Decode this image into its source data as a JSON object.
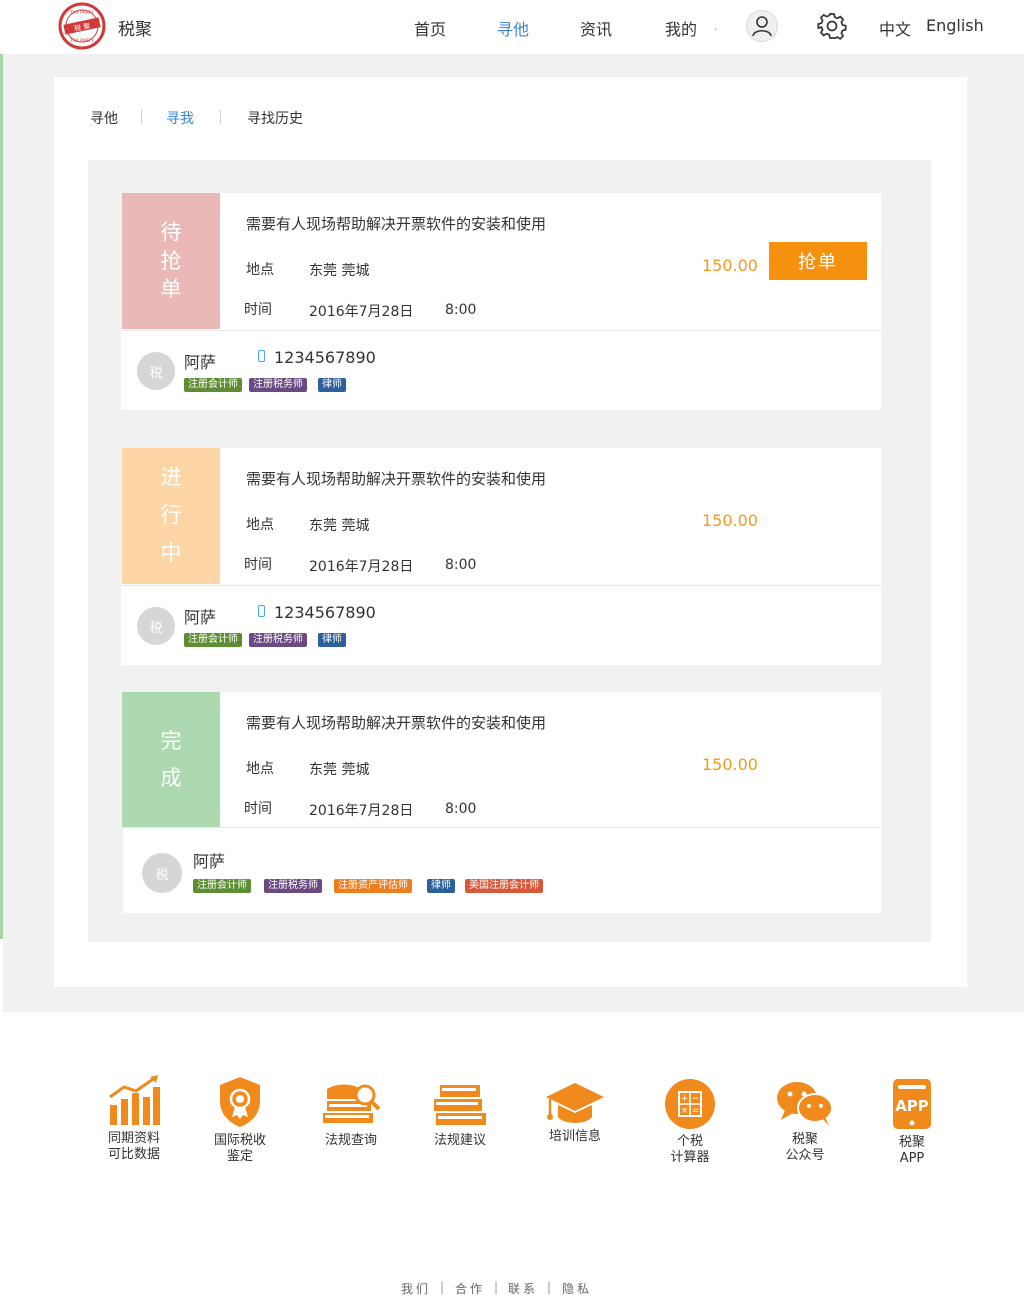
{
  "colors": {
    "accent": "#3b86d6",
    "orange": "#f6900f",
    "price": "#f39a1e",
    "status_pending": "#ebb8b8",
    "status_progress": "#fed6a6",
    "status_done": "#acd9b0",
    "tag_accountant": "#5e8e34",
    "tag_tax_agent": "#6a4a82",
    "tag_asset": "#ed7d1e",
    "tag_lawyer": "#2d5f9a",
    "tag_us_cpa": "#d8593a"
  },
  "header": {
    "logo_alt": "TAX PARTY 税聚",
    "brand": "税聚",
    "nav": [
      "首页",
      "寻他",
      "资讯",
      "我的"
    ],
    "nav_active": "寻他",
    "nav_dot": ".",
    "icons": [
      "user-icon",
      "gear-icon"
    ],
    "lang_zh": "中文",
    "lang_en": "English"
  },
  "tabs": [
    "寻他",
    "寻我",
    "寻找历史"
  ],
  "tab_active": "寻我",
  "orders": [
    {
      "status": "待抢单",
      "title": "需要有人现场帮助解决开票软件的安装和使用",
      "location_label": "地点",
      "location": "东莞 莞城",
      "time_label": "时间",
      "date": "2016年7月28日",
      "time": "8:00",
      "price": "150.00",
      "action": "抢单",
      "user": {
        "avatar": "税",
        "name": "阿萨",
        "phone": "1234567890",
        "tags": [
          "注册会计师",
          "注册税务师",
          "律师"
        ]
      }
    },
    {
      "status": "进行中",
      "title": "需要有人现场帮助解决开票软件的安装和使用",
      "location_label": "地点",
      "location": "东莞 莞城",
      "time_label": "时间",
      "date": "2016年7月28日",
      "time": "8:00",
      "price": "150.00",
      "user": {
        "avatar": "税",
        "name": "阿萨",
        "phone": "1234567890",
        "tags": [
          "注册会计师",
          "注册税务师",
          "律师"
        ]
      }
    },
    {
      "status": "完成",
      "title": "需要有人现场帮助解决开票软件的安装和使用",
      "location_label": "地点",
      "location": "东莞 莞城",
      "time_label": "时间",
      "date": "2016年7月28日",
      "time": "8:00",
      "price": "150.00",
      "user": {
        "avatar": "税",
        "name": "阿萨",
        "tags": [
          "注册会计师",
          "注册税务师",
          "注册资产评估师",
          "律师",
          "美国注册会计师"
        ]
      }
    }
  ],
  "footer_icons": [
    {
      "line1": "同期资料",
      "line2": "可比数据",
      "icon": "bar-chart-icon"
    },
    {
      "line1": "国际税收",
      "line2": "鉴定",
      "icon": "shield-medal-icon"
    },
    {
      "line1": "法规查询",
      "line2": "",
      "icon": "book-search-icon"
    },
    {
      "line1": "法规建议",
      "line2": "",
      "icon": "books-icon"
    },
    {
      "line1": "培训信息",
      "line2": "",
      "icon": "graduation-cap-icon"
    },
    {
      "line1": "个税",
      "line2": "计算器",
      "icon": "calculator-icon"
    },
    {
      "line1": "税聚",
      "line2": "公众号",
      "icon": "wechat-icon"
    },
    {
      "line1": "税聚",
      "line2": "APP",
      "icon": "app-icon"
    }
  ],
  "footer_links": [
    "我们",
    "合作",
    "联系",
    "隐私"
  ]
}
